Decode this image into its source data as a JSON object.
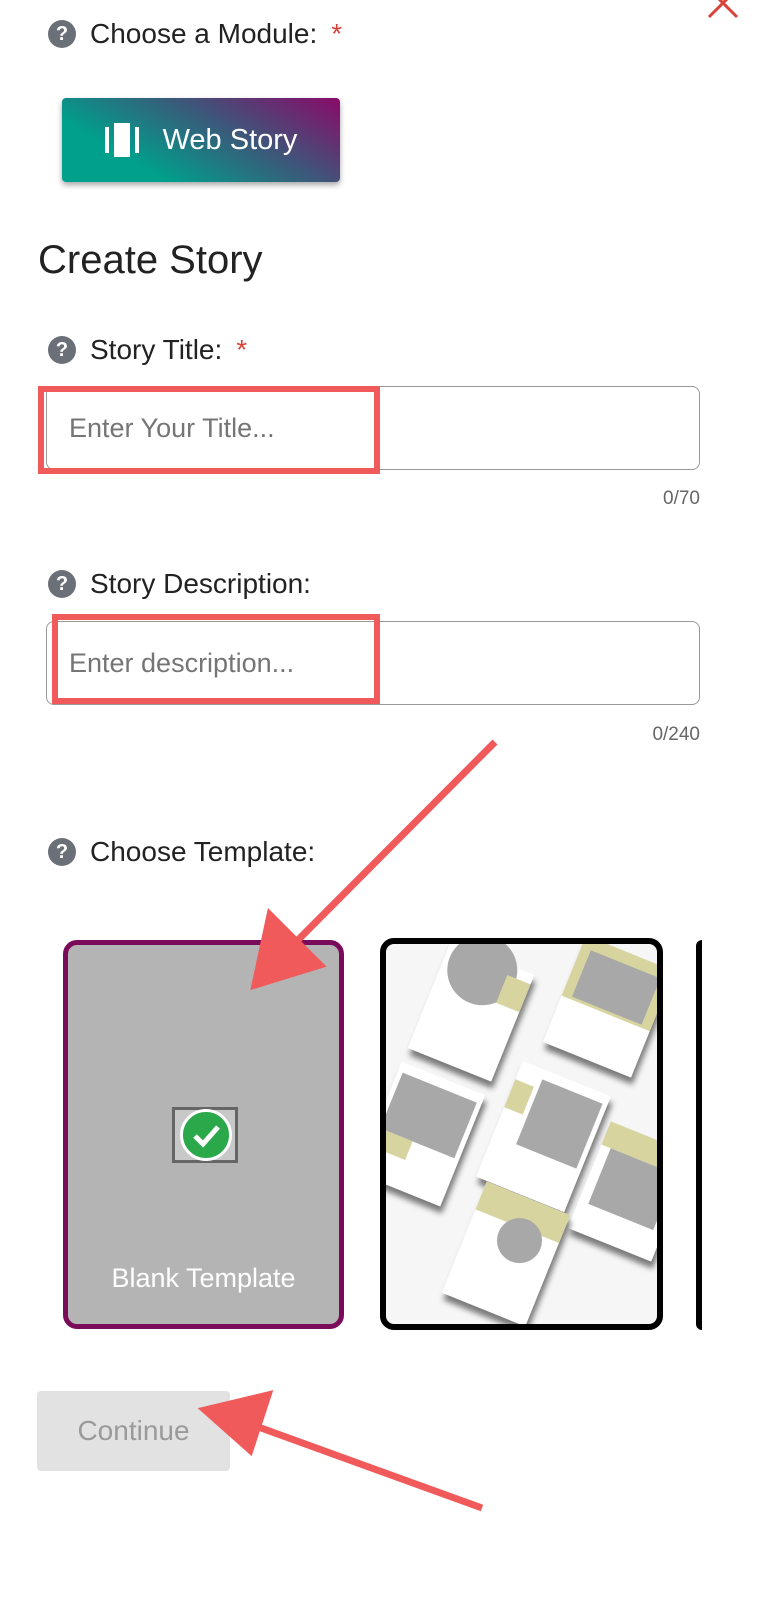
{
  "module": {
    "label": "Choose a Module:",
    "required_mark": "*",
    "button_label": "Web Story",
    "button_icon": "web-story-icon"
  },
  "heading": "Create Story",
  "title_field": {
    "label": "Story Title:",
    "required_mark": "*",
    "placeholder": "Enter Your Title...",
    "value": "",
    "counter": "0/70"
  },
  "description_field": {
    "label": "Story Description:",
    "placeholder": "Enter description...",
    "value": "",
    "counter": "0/240"
  },
  "template": {
    "label": "Choose Template:",
    "items": [
      {
        "name": "Blank Template",
        "selected": true
      },
      {
        "name": "",
        "selected": false
      }
    ]
  },
  "continue_label": "Continue",
  "colors": {
    "accent": "#7a0a5a",
    "required": "#d9433a",
    "highlight": "#f05a5a",
    "check": "#2aa84a"
  }
}
